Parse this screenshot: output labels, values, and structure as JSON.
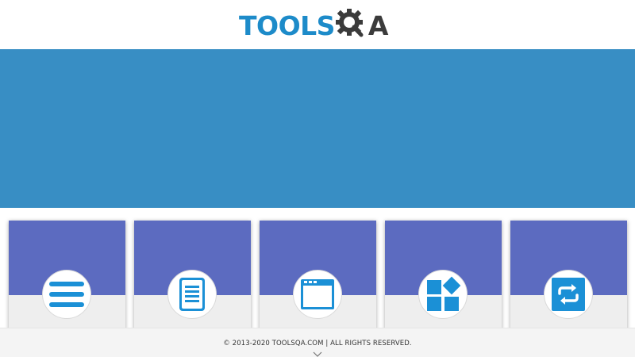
{
  "colors": {
    "brand_blue": "#1d8bc9",
    "brand_dark": "#3b3b3b",
    "banner_blue": "#388ec4",
    "card_purple": "#5c6bc0",
    "card_gray": "#eeeeee",
    "icon_blue": "#1b90d6"
  },
  "header": {
    "logo_part1": "TOOLS",
    "logo_part2": "Q",
    "logo_part3": "A"
  },
  "cards": [
    {
      "icon": "list-icon"
    },
    {
      "icon": "document-icon"
    },
    {
      "icon": "browser-window-icon"
    },
    {
      "icon": "widgets-icon"
    },
    {
      "icon": "interactions-icon"
    }
  ],
  "footer": {
    "copyright": "© 2013-2020 TOOLSQA.COM | ALL RIGHTS RESERVED."
  }
}
